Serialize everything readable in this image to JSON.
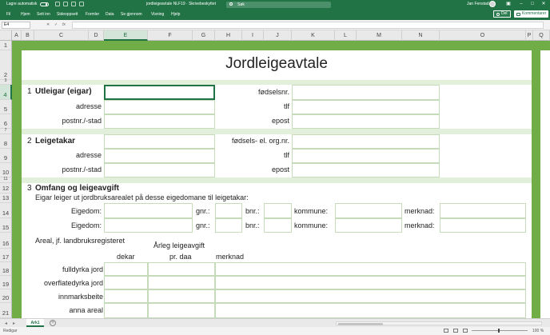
{
  "titlebar": {
    "autosave_label": "Lagre automatisk",
    "doc_title": "jordleigeavtale NLF19 · Skrivebeskyttet",
    "search_placeholder": "Søk",
    "user_name": "Jan Fenstad",
    "minimize": "–",
    "maximize": "□",
    "close": "✕"
  },
  "ribbon": {
    "tabs": [
      "Fil",
      "Hjem",
      "Sett inn",
      "Sideoppsett",
      "Formler",
      "Data",
      "Se gjennom",
      "Visning",
      "Hjelp"
    ],
    "share_label": "Del",
    "comments_label": "Kommentarer"
  },
  "formula_bar": {
    "name_box": "E4",
    "cancel": "✕",
    "enter": "✓",
    "fx": "fx",
    "value": ""
  },
  "columns": [
    "A",
    "B",
    "C",
    "D",
    "E",
    "F",
    "G",
    "H",
    "I",
    "J",
    "K",
    "L",
    "M",
    "N",
    "O",
    "P",
    "Q"
  ],
  "rows": [
    "1",
    "2",
    "3",
    "4",
    "5",
    "6",
    "7",
    "8",
    "9",
    "10",
    "11",
    "12",
    "13",
    "14",
    "15",
    "16",
    "17",
    "18",
    "19",
    "20",
    "21"
  ],
  "sheet": {
    "heading": "Jordleigeavtale",
    "utleigar": {
      "title_num": "1",
      "title": "Utleigar (eigar)",
      "adresse": "adresse",
      "postnr": "postnr./-stad",
      "fodselsnr": "fødselsnr.",
      "tlf": "tlf",
      "epost": "epost"
    },
    "leigetakar": {
      "title_num": "2",
      "title": "Leigetakar",
      "adresse": "adresse",
      "postnr": "postnr./-stad",
      "fodselsnr": "fødsels- el. org.nr.",
      "tlf": "tlf",
      "epost": "epost"
    },
    "omfang": {
      "title_num": "3",
      "title": "Omfang og leigeavgift",
      "intro": "Eigar leiger ut jordbruksarealet på desse eigedomane til leigetakar:",
      "eigedom": "Eigedom:",
      "gnr": "gnr.:",
      "bnr": "bnr.:",
      "kommune": "kommune:",
      "merknad": "merknad:",
      "areal_header": "Areal, jf. landbruksregisteret",
      "arleg_header": "Årleg leigeavgift",
      "dekar": "dekar",
      "pr_daa": "pr. daa",
      "merknad_col": "merknad",
      "land_types": [
        "fulldyrka jord",
        "overflatedyrka jord",
        "innmarksbeite",
        "anna areal"
      ]
    }
  },
  "tabbar": {
    "prev": "◂",
    "next": "▸",
    "sheet_name": "Ark1",
    "add": "+"
  },
  "status": {
    "mode": "Redigar",
    "zoom": "100 %"
  }
}
